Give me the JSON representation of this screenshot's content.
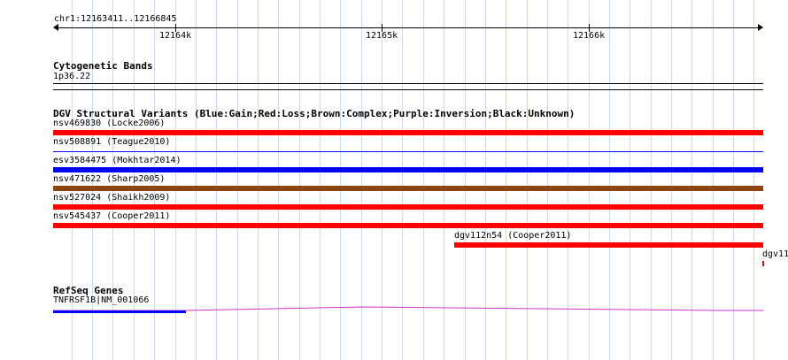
{
  "ruler": {
    "location_label": "chr1:12163411..12166845",
    "ticks": [
      {
        "label": "12164k",
        "pos": 12164000
      },
      {
        "label": "12165k",
        "pos": 12165000
      },
      {
        "label": "12166k",
        "pos": 12166000
      }
    ],
    "start": 12163411,
    "end": 12166845
  },
  "cytoband": {
    "title": "Cytogenetic Bands",
    "band_label": "1p36.22"
  },
  "dgv": {
    "title": "DGV Structural Variants (Blue:Gain;Red:Loss;Brown:Complex;Purple:Inversion;Black:Unknown)",
    "colors": {
      "gain": "#0000ff",
      "loss": "#ff0000",
      "complex": "#8b4513",
      "unknown": "#000000"
    },
    "variants": [
      {
        "label": "nsv469830 (Locke2006)",
        "type": "loss",
        "thick": true,
        "start": 12163411,
        "end": 12166845
      },
      {
        "label": "nsv508891 (Teague2010)",
        "type": "gain",
        "thick": false,
        "start": 12163411,
        "end": 12166845
      },
      {
        "label": "esv3584475 (Mokhtar2014)",
        "type": "gain",
        "thick": true,
        "start": 12163411,
        "end": 12166845
      },
      {
        "label": "nsv471622 (Sharp2005)",
        "type": "complex",
        "thick": true,
        "start": 12163411,
        "end": 12166845
      },
      {
        "label": "nsv527024 (Shaikh2009)",
        "type": "loss",
        "thick": true,
        "start": 12163411,
        "end": 12166845
      },
      {
        "label": "nsv545437 (Cooper2011)",
        "type": "loss",
        "thick": true,
        "start": 12163411,
        "end": 12166845
      },
      {
        "label": "dgv112n54 (Cooper2011)",
        "type": "loss",
        "thick": true,
        "start": 12165350,
        "end": 12166845
      },
      {
        "label": "dgv11",
        "type": "loss",
        "thick": true,
        "start": 12166840,
        "end": 12166845
      }
    ]
  },
  "refseq": {
    "title": "RefSeq Genes",
    "gene_label": "TNFRSF1B|NM_001066",
    "colors": {
      "gene": "#0000ff",
      "intron": "#cc33cc"
    }
  }
}
